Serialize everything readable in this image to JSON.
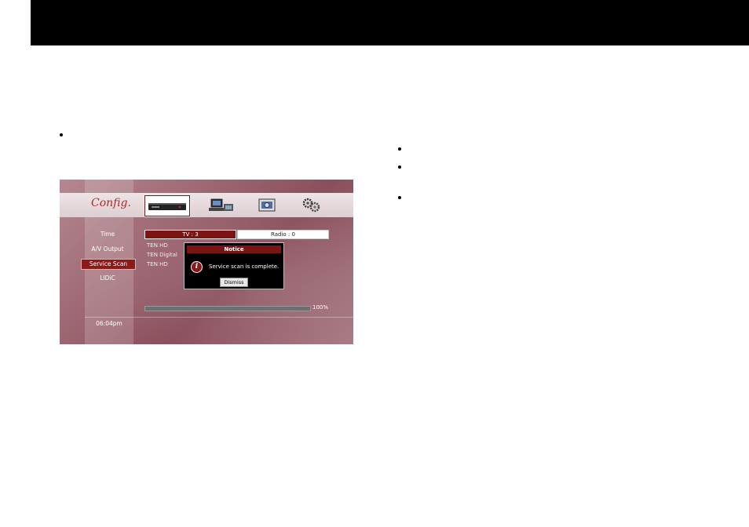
{
  "config": {
    "title": "Config."
  },
  "icons": [
    "set-top-box-icon",
    "network-computer-icon",
    "screen-settings-icon",
    "gears-icon"
  ],
  "menu": [
    {
      "label": "Time"
    },
    {
      "label": "A/V Output"
    },
    {
      "label": "Service Scan"
    },
    {
      "label": "LIDiC"
    }
  ],
  "clock": "06:04pm",
  "tabs": {
    "tv": "TV : 3",
    "radio": "Radio : 0"
  },
  "channels": [
    "TEN HD",
    "TEN Digital",
    "TEN HD"
  ],
  "notice": {
    "title": "Notice",
    "message": "Service scan is complete.",
    "dismiss": "Dismiss"
  },
  "scan": {
    "progress_label": "100%",
    "progress_fraction": 1.0
  },
  "colors": {
    "accent": "#7d1414",
    "background": "#a06b76"
  }
}
